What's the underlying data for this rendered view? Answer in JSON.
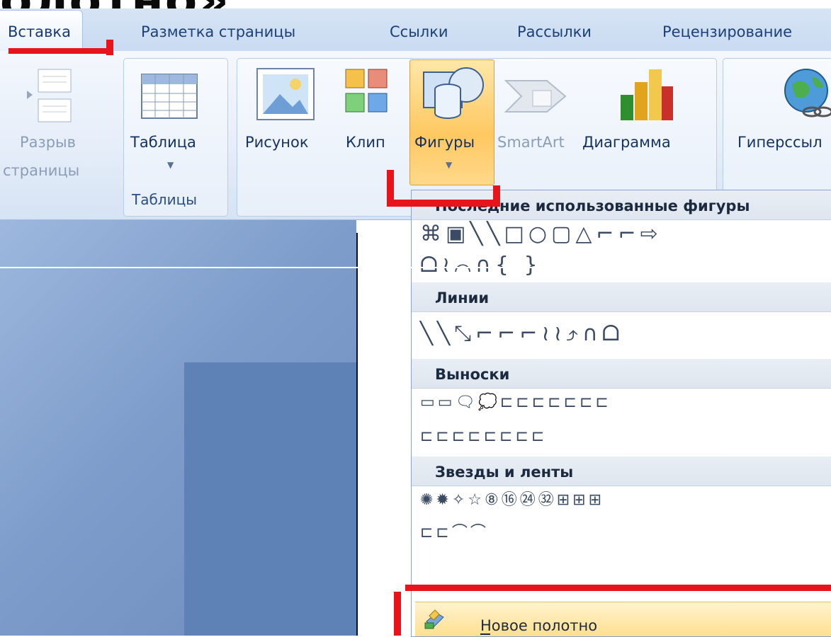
{
  "slide_title": "олотно»",
  "tabs": [
    {
      "label": "Вставка",
      "active": true
    },
    {
      "label": "Разметка страницы"
    },
    {
      "label": "Ссылки"
    },
    {
      "label": "Рассылки"
    },
    {
      "label": "Рецензирование"
    }
  ],
  "ribbon": {
    "page_break": {
      "line1": "Разрыв",
      "line2": "страницы"
    },
    "table": {
      "label": "Таблица",
      "group": "Таблицы"
    },
    "picture": {
      "label": "Рисунок"
    },
    "clip": {
      "label": "Клип"
    },
    "shapes": {
      "label": "Фигуры"
    },
    "smartart": {
      "label": "SmartArt"
    },
    "chart": {
      "label": "Диаграмма"
    },
    "hyperlink": {
      "label": "Гиперссыл"
    }
  },
  "shapes_menu": {
    "sections": [
      {
        "title": "Последние использованные фигуры",
        "rows": [
          "⌘▣╲╲□○▢△⌐⌐⇨",
          "ᗝ≀⌒∩{ }"
        ]
      },
      {
        "title": "Линии",
        "rows": [
          "╲╲⤡⌐⌐⌐≀≀⤴∩ᗝ"
        ]
      },
      {
        "title": "Выноски",
        "rows": [
          "▭▭🗨💭⊏⊏⊏⊏⊏⊏⊏",
          "⊏⊏⊏⊏⊏⊏⊏⊏"
        ]
      },
      {
        "title": "Звезды и ленты",
        "rows": [
          "✺✹✧☆⑧⑯㉔㉜⊞⊞⊞",
          "⊏⊏⌒⌒"
        ]
      }
    ],
    "footer": {
      "label": "Новое полотно",
      "underline_char": "Н"
    }
  },
  "colors": {
    "highlight_red": "#e8141b",
    "active_button": "#ffd06b",
    "ribbon_text": "#15325f",
    "slide_blue": "#7f9dcb"
  }
}
